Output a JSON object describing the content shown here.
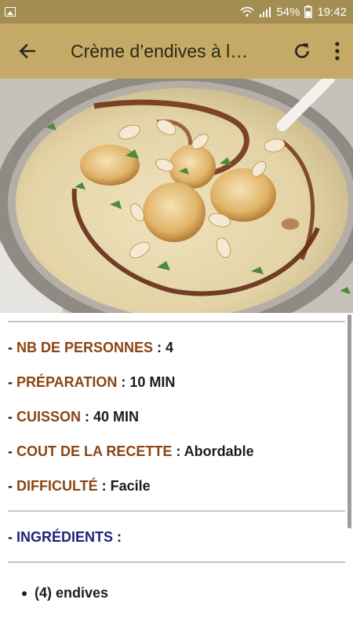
{
  "status_bar": {
    "battery_percent": "54%",
    "time": "19:42"
  },
  "app_bar": {
    "title": "Crème d’endives à l…"
  },
  "recipe": {
    "details": [
      {
        "label": "NB DE PERSONNES",
        "value": "4",
        "sep": " : "
      },
      {
        "label": "PRÉPARATION",
        "value": "10 MIN",
        "sep": " : "
      },
      {
        "label": "CUISSON",
        "value": "40 MIN",
        "sep": " : "
      },
      {
        "label": "COUT DE LA RECETTE",
        "value": "Abordable",
        "sep": " :  "
      },
      {
        "label": "DIFFICULTÉ",
        "value": "Facile",
        "sep": " : "
      }
    ],
    "ingredients_heading": "INGRÉDIENTS",
    "ingredients": [
      "(4) endives"
    ]
  },
  "colors": {
    "status_bar": "#a48d52",
    "app_bar": "#c4aa66",
    "label_brown": "#8b4513",
    "label_blue": "#22227a"
  }
}
